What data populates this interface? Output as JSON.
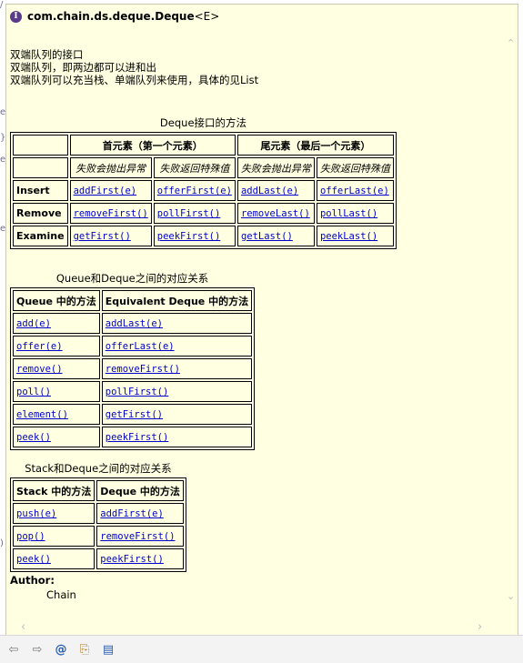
{
  "header": {
    "title": "com.chain.ds.deque.Deque",
    "generic": "<E>"
  },
  "description": [
    "双端队列的接口",
    "双端队列，即两边都可以进和出",
    "双端队列可以充当栈、单端队列来使用，具体的见List"
  ],
  "table1": {
    "caption": "Deque接口的方法",
    "group_headers": [
      "首元素（第一个元素）",
      "尾元素（最后一个元素）"
    ],
    "sub_headers": [
      "失败会抛出异常",
      "失败返回特殊值",
      "失败会抛出异常",
      "失败返回特殊值"
    ],
    "rows": [
      {
        "label": "Insert",
        "cells": [
          "addFirst(e)",
          "offerFirst(e)",
          "addLast(e)",
          "offerLast(e)"
        ]
      },
      {
        "label": "Remove",
        "cells": [
          "removeFirst()",
          "pollFirst()",
          "removeLast()",
          "pollLast()"
        ]
      },
      {
        "label": "Examine",
        "cells": [
          "getFirst()",
          "peekFirst()",
          "getLast()",
          "peekLast()"
        ]
      }
    ]
  },
  "table2": {
    "caption": "Queue和Deque之间的对应关系",
    "headers": [
      "Queue 中的方法",
      "Equivalent Deque 中的方法"
    ],
    "rows": [
      [
        "add(e)",
        "addLast(e)"
      ],
      [
        "offer(e)",
        "offerLast(e)"
      ],
      [
        "remove()",
        "removeFirst()"
      ],
      [
        "poll()",
        "pollFirst()"
      ],
      [
        "element()",
        "getFirst()"
      ],
      [
        "peek()",
        "peekFirst()"
      ]
    ]
  },
  "table3": {
    "caption": "Stack和Deque之间的对应关系",
    "headers": [
      "Stack 中的方法",
      "Deque 中的方法"
    ],
    "rows": [
      [
        "push(e)",
        "addFirst(e)"
      ],
      [
        "pop()",
        "removeFirst()"
      ],
      [
        "peek()",
        "peekFirst()"
      ]
    ]
  },
  "author": {
    "label": "Author:",
    "name": "Chain"
  },
  "toolbar": {
    "icons": [
      "back-icon",
      "forward-icon",
      "at-icon",
      "open-declaration-icon",
      "open-external-doc-icon"
    ]
  },
  "colors": {
    "popup_bg": "#ffffe1",
    "link": "#0000cc"
  }
}
